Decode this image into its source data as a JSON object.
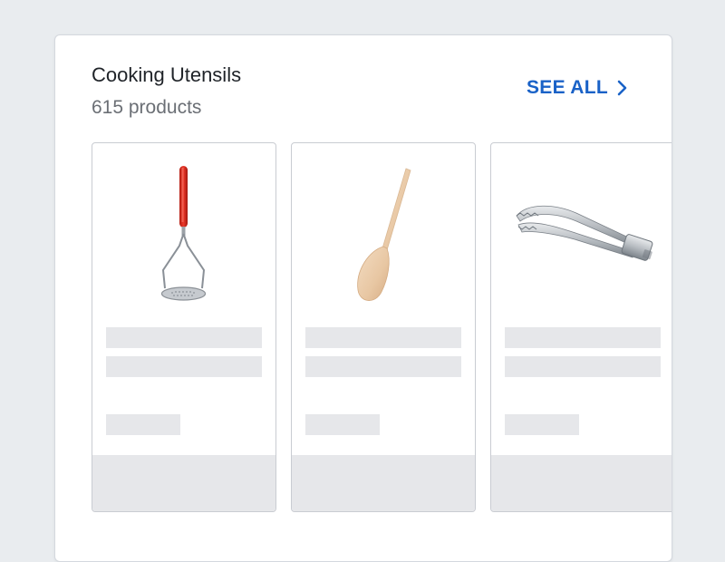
{
  "section": {
    "title": "Cooking Utensils",
    "product_count": "615 products",
    "see_all_label": "SEE ALL",
    "accent_color": "#1a62c7"
  },
  "products": [
    {
      "image": "potato-masher-icon"
    },
    {
      "image": "wooden-spoon-icon"
    },
    {
      "image": "kitchen-tongs-icon"
    }
  ]
}
